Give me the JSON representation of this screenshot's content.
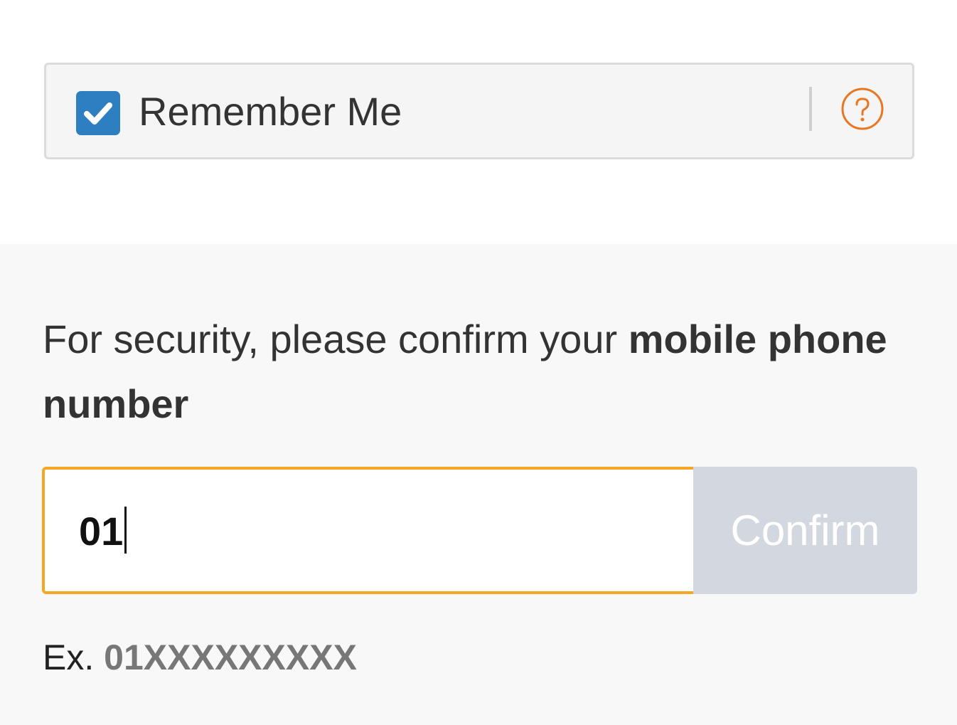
{
  "remember": {
    "label": "Remember Me",
    "checked": true,
    "checkbox_icon": "check-icon",
    "help_icon": "question-circle-icon"
  },
  "security": {
    "prompt_prefix": "For security, please confirm your ",
    "prompt_bold": "mobile phone number"
  },
  "phone": {
    "value": "01",
    "confirm_label": "Confirm"
  },
  "example": {
    "prefix": "Ex.",
    "value": "01XXXXXXXXX"
  },
  "colors": {
    "checkbox": "#2d7fc1",
    "help_icon": "#e87722",
    "input_focus_border": "#f5a623",
    "confirm_disabled": "#d2d7e0"
  }
}
